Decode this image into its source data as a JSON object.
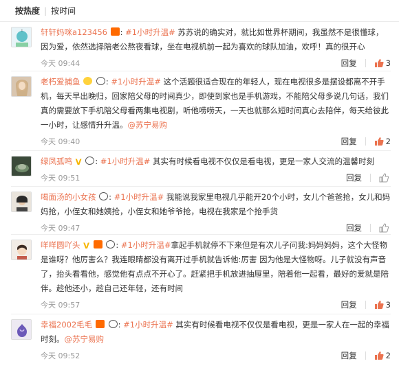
{
  "sort": {
    "hot": "按热度",
    "time": "按时间"
  },
  "actions": {
    "reply": "回复"
  },
  "comments": [
    {
      "user": "轩轩妈咪a123456",
      "topic": "#1小时升温#",
      "text": " 苏苏说的确实对，就比如世界杯期间，我虽然不是很懂球，因为爱，依然选择陪老公熬夜看球，坐在电视机前一起为喜欢的球队加油，欢呼！真的很开心",
      "mention": "",
      "time": "今天 09:44",
      "likes": "3"
    },
    {
      "user": "老朽爱捕鱼",
      "topic": "#1小时升温#",
      "text": " 这个活题很适合现在的年轻人，现在电视很多是摆设都离不开手机，每天早出晚归，回家陪父母的时间真少，即使到家也是手机游戏，不能陪父母多说几句话，我们真的需要放下手机陪父母看两集电视剧，听他唠唠天，一天也就那么短时间真心去陪伴，每天给彼此一小时，让感情升升温。",
      "mention": "@苏宁易购",
      "time": "今天 09:40",
      "likes": "2"
    },
    {
      "user": "绿凤孤鸣",
      "topic": "#1小时升温#",
      "text": " 其实有时候看电视不仅仅是看电视，更是一家人交流的温馨时刻",
      "mention": "",
      "time": "今天 09:51",
      "likes": ""
    },
    {
      "user": "喝面汤的小女孩",
      "topic": "#1小时升温#",
      "text": " 我能说我家里电视几乎能开20个小时，女儿个爸爸抢，女儿和妈妈抢，小侄女和她姨抢，小侄女和她爷爷抢，电视在我家是个抢手货",
      "mention": "",
      "time": "今天 09:47",
      "likes": ""
    },
    {
      "user": "咩咩圆吖头",
      "topic": "#1小时升温#",
      "text": "拿起手机就停不下来但是有次儿子问我:妈妈妈妈，这个大怪物是谁呀？他厉害么？我连眼睛都没有离开过手机就告诉他:厉害 因为他是大怪物呀。儿子就没有声音了，抬头看看他，感觉他有点点不开心了。赶紧把手机放进抽屉里，陪着他一起看，最好的爱就是陪伴。趁他还小，趁自己还年轻，还有时间",
      "mention": "",
      "time": "今天 09:57",
      "likes": "3"
    },
    {
      "user": "幸福2002毛毛",
      "topic": "#1小时升温#",
      "text": " 其实有时候看电视不仅仅是看电视，更是一家人在一起的幸福时刻。",
      "mention": "@苏宁易购",
      "time": "今天 09:52",
      "likes": "2"
    }
  ],
  "colors": {
    "accent": "#eb7350",
    "like": "#eb7350",
    "muted": "#999999"
  }
}
